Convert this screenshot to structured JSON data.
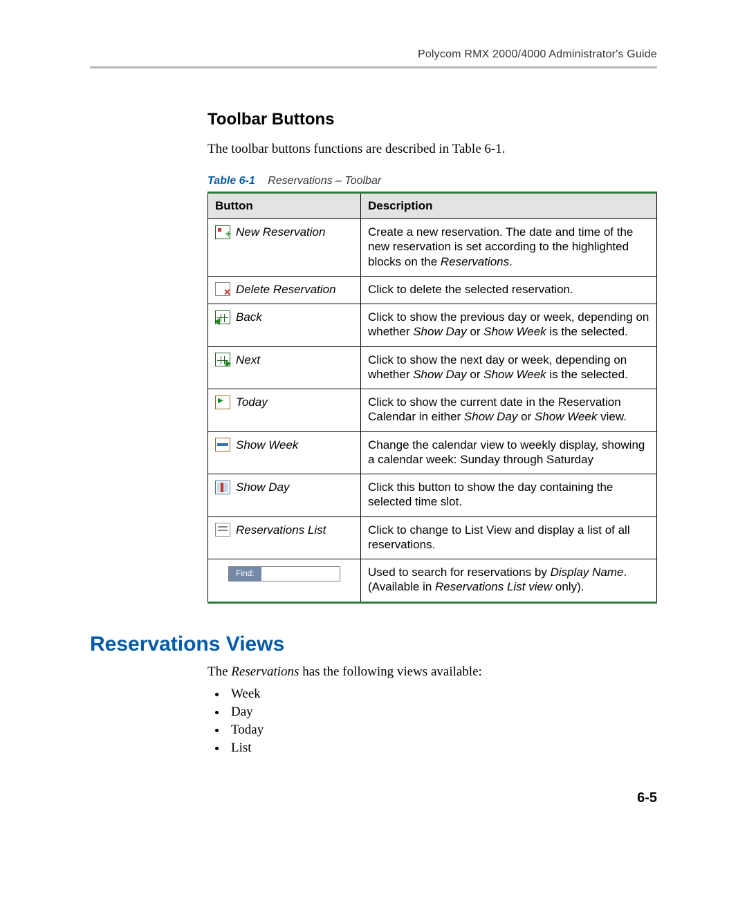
{
  "header": {
    "running": "Polycom RMX 2000/4000 Administrator's Guide"
  },
  "section1": {
    "heading": "Toolbar Buttons",
    "lead": "The toolbar buttons functions are described in Table 6-1."
  },
  "table": {
    "caption_label": "Table 6-1",
    "caption_title": "Reservations – Toolbar",
    "head": {
      "button": "Button",
      "description": "Description"
    },
    "rows": [
      {
        "icon": "new-reservation-icon",
        "label": "New Reservation",
        "desc_pre": "Create a new reservation. The date and time of the new reservation is set according to the highlighted blocks on the ",
        "desc_em": "Reservations",
        "desc_post": "."
      },
      {
        "icon": "delete-reservation-icon",
        "label": "Delete Reservation",
        "desc_pre": "Click to delete the selected reservation.",
        "desc_em": "",
        "desc_post": ""
      },
      {
        "icon": "back-icon",
        "label": "Back",
        "desc_pre": "Click to show the previous day or week, depending on whether ",
        "desc_em": "Show Day",
        "desc_mid": " or ",
        "desc_em2": "Show Week",
        "desc_post": " is the selected."
      },
      {
        "icon": "next-icon",
        "label": "Next",
        "desc_pre": "Click to show the next day or week, depending on whether ",
        "desc_em": "Show Day",
        "desc_mid": " or ",
        "desc_em2": "Show Week",
        "desc_post": " is the selected."
      },
      {
        "icon": "today-icon",
        "label": "Today",
        "desc_pre": "Click to show the current date in the Reservation Calendar in either ",
        "desc_em": "Show Day",
        "desc_mid": " or ",
        "desc_em2": "Show Week",
        "desc_post": " view."
      },
      {
        "icon": "show-week-icon",
        "label": "Show Week",
        "desc_pre": "Change the calendar view to weekly display, showing a calendar week: Sunday through Saturday",
        "desc_em": "",
        "desc_post": ""
      },
      {
        "icon": "show-day-icon",
        "label": "Show Day",
        "desc_pre": "Click this button to show the day containing the selected time slot.",
        "desc_em": "",
        "desc_post": ""
      },
      {
        "icon": "reservations-list-icon",
        "label": "Reservations List",
        "desc_pre": "Click to change to List View and display a list of all reservations.",
        "desc_em": "",
        "desc_post": ""
      },
      {
        "icon": "find-icon",
        "find_label": "Find:",
        "label": "",
        "desc_pre": "Used to search for reservations by ",
        "desc_em": "Display Name",
        "desc_mid": ". (Available in ",
        "desc_em2": "Reservations List view",
        "desc_post": " only)."
      }
    ]
  },
  "section2": {
    "heading": "Reservations Views",
    "intro_pre": "The ",
    "intro_em": "Reservations",
    "intro_post": " has the following views available:",
    "items": [
      "Week",
      "Day",
      "Today",
      "List"
    ]
  },
  "page_number": "6-5"
}
